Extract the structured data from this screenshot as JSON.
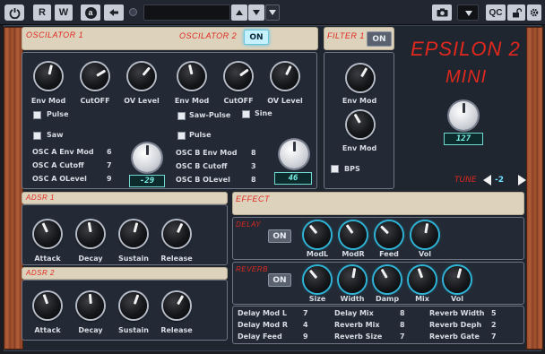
{
  "toolbar": {
    "read_label": "R",
    "write_label": "W",
    "auto_label": "a",
    "qc_label": "QC"
  },
  "brand": {
    "title": "EPSILON 2",
    "subtitle": "MINI"
  },
  "colors": {
    "accent": "#e0281e",
    "lcd": "#78f2e6",
    "on_lit": "#c6f2ff"
  },
  "osc1": {
    "title": "OSCILATOR 1",
    "knobs": [
      {
        "label": "Env Mod",
        "level": 0.55
      },
      {
        "label": "CutOFF",
        "level": 0.72
      },
      {
        "label": "OV Level",
        "level": 0.65
      }
    ],
    "pulse_label": "Pulse",
    "saw_label": "Saw"
  },
  "osc2": {
    "title": "OSCILATOR 2",
    "on_label": "ON",
    "knobs": [
      {
        "label": "Env Mod",
        "level": 0.45
      },
      {
        "label": "CutOFF",
        "level": 0.7
      },
      {
        "label": "OV Level",
        "level": 0.6
      }
    ],
    "sawpulse_label": "Saw-Pulse",
    "sine_label": "Sine",
    "pulse_label": "Pulse"
  },
  "osc_a": {
    "rows": [
      {
        "label": "OSC A Env Mod",
        "value": "6"
      },
      {
        "label": "OSC A Cutoff",
        "value": "7"
      },
      {
        "label": "OSC A OLevel",
        "value": "9"
      }
    ],
    "lcd": "-29"
  },
  "osc_b": {
    "rows": [
      {
        "label": "OSC B Env Mod",
        "value": "8"
      },
      {
        "label": "OSC B Cutoff",
        "value": "3"
      },
      {
        "label": "OSC B OLevel",
        "value": "8"
      }
    ],
    "lcd": "46"
  },
  "filter": {
    "title": "FILTER 1",
    "on_label": "ON",
    "knob1_label": "Env Mod",
    "knob2_label": "Env Mod",
    "bps_label": "BPS"
  },
  "master": {
    "lcd": "127",
    "tune_label": "TUNE",
    "tune_value": "-2"
  },
  "adsr1": {
    "title": "ADSR 1",
    "knobs": [
      {
        "label": "Attack"
      },
      {
        "label": "Decay"
      },
      {
        "label": "Sustain"
      },
      {
        "label": "Release"
      }
    ]
  },
  "adsr2": {
    "title": "ADSR 2",
    "knobs": [
      {
        "label": "Attack"
      },
      {
        "label": "Decay"
      },
      {
        "label": "Sustain"
      },
      {
        "label": "Release"
      }
    ]
  },
  "effect": {
    "title": "EFFECT",
    "delay": {
      "title": "DELAY",
      "on_label": "ON",
      "knobs": [
        {
          "label": "ModL"
        },
        {
          "label": "ModR"
        },
        {
          "label": "Feed"
        },
        {
          "label": "Vol"
        }
      ]
    },
    "reverb": {
      "title": "REVERB",
      "on_label": "ON",
      "knobs": [
        {
          "label": "Size"
        },
        {
          "label": "Width"
        },
        {
          "label": "Damp"
        },
        {
          "label": "Mix"
        },
        {
          "label": "Vol"
        }
      ]
    },
    "params": [
      [
        {
          "label": "Delay Mod L",
          "value": "7"
        },
        {
          "label": "Delay Mix",
          "value": "8"
        },
        {
          "label": "Reverb Width",
          "value": "5"
        }
      ],
      [
        {
          "label": "Delay Mod R",
          "value": "4"
        },
        {
          "label": "Reverb Mix",
          "value": "8"
        },
        {
          "label": "Reverb Deph",
          "value": "2"
        }
      ],
      [
        {
          "label": "Delay Feed",
          "value": "9"
        },
        {
          "label": "Reverb Size",
          "value": "7"
        },
        {
          "label": "Reverb Gate",
          "value": "7"
        }
      ]
    ]
  }
}
